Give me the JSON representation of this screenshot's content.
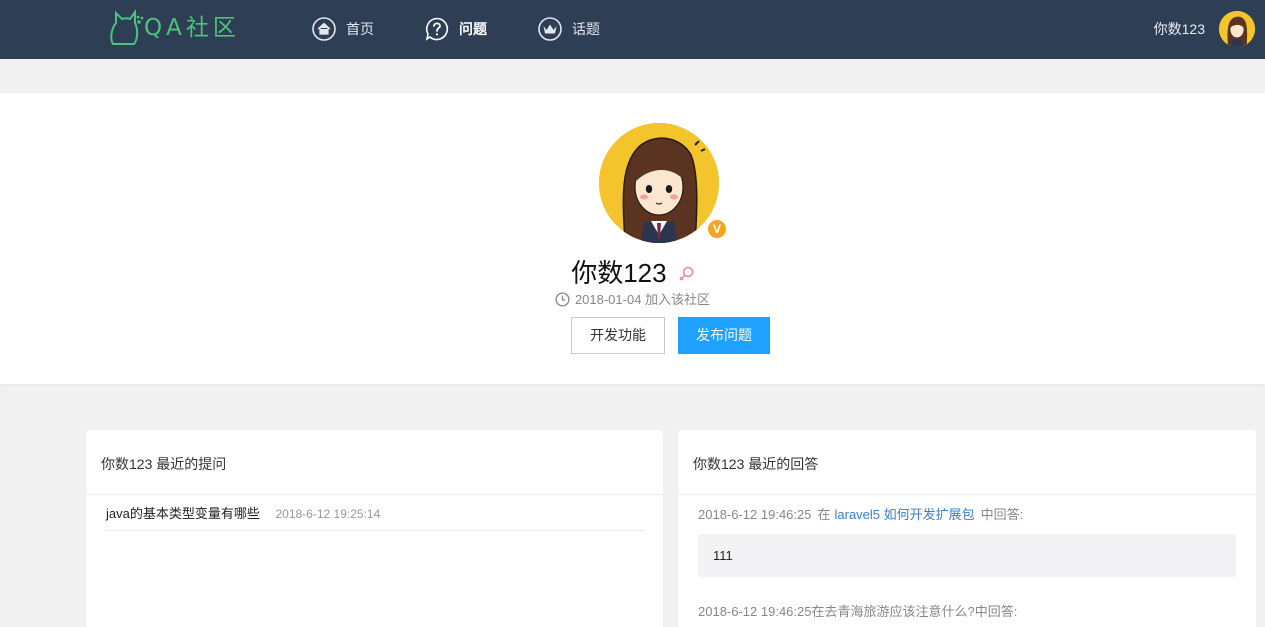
{
  "nav": {
    "logo_text": "QA社区",
    "items": [
      {
        "label": "首页",
        "icon": "home-icon"
      },
      {
        "label": "问题",
        "icon": "question-icon"
      },
      {
        "label": "话题",
        "icon": "crown-icon"
      }
    ],
    "username": "你数123"
  },
  "profile": {
    "name": "你数123",
    "joined": "2018-01-04 加入该社区",
    "dev_button": "开发功能",
    "publish_button": "发布问题",
    "verify_badge": "V"
  },
  "questions": {
    "title": "你数123 最近的提问",
    "items": [
      {
        "title": "java的基本类型变量有哪些",
        "time": "2018-6-12 19:25:14"
      }
    ]
  },
  "answers": {
    "title": "你数123 最近的回答",
    "items": [
      {
        "time": "2018-6-12 19:46:25",
        "in": "在",
        "question": "laravel5 如何开发扩展包",
        "suffix": "中回答:",
        "content": "111"
      },
      {
        "time": "2018-6-12 19:46:25",
        "in": "在",
        "question": "去青海旅游应该注意什么?",
        "suffix": "中回答:"
      }
    ]
  },
  "colors": {
    "nav_bg": "#2e3e55",
    "logo": "#4cc27a",
    "primary": "#1ea1ff",
    "link": "#3a7fc8",
    "badge": "#f7a51c"
  }
}
